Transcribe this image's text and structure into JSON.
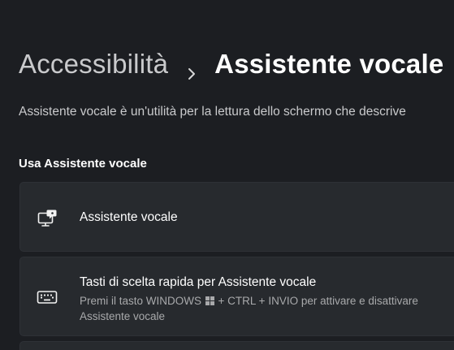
{
  "breadcrumb": {
    "parent": "Accessibilità",
    "separator_icon": "chevron-right-icon",
    "current": "Assistente vocale"
  },
  "description": "Assistente vocale è un'utilità per la lettura dello schermo che descrive",
  "section": {
    "heading": "Usa Assistente vocale"
  },
  "cards": [
    {
      "icon": "narrator-monitor-icon",
      "title": "Assistente vocale"
    },
    {
      "icon": "keyboard-icon",
      "title": "Tasti di scelta rapida per Assistente vocale",
      "subtitle_before": "Premi il tasto WINDOWS",
      "subtitle_glyph": "windows-logo-icon",
      "subtitle_after": "+ CTRL + INVIO per attivare e disattivare Assistente vocale"
    }
  ],
  "colors": {
    "background": "#1c1e22",
    "card": "#272a2e",
    "text_primary": "#ffffff",
    "text_secondary": "#c9cacc",
    "text_muted": "#a8a9ab"
  }
}
